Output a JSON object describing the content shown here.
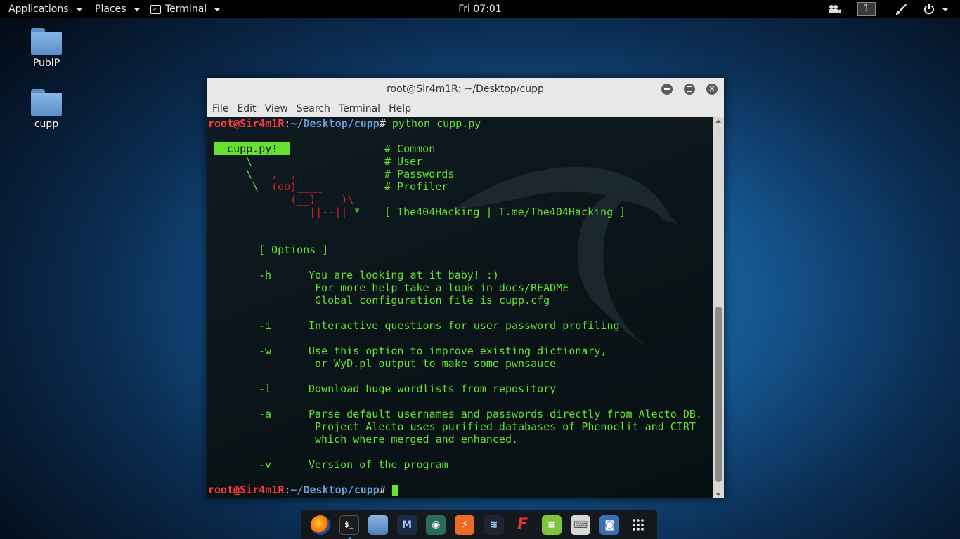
{
  "topbar": {
    "applications": "Applications",
    "places": "Places",
    "terminal_menu": "Terminal",
    "clock": "Fri 07:01",
    "workspace": "1"
  },
  "desktop": {
    "icons": [
      {
        "label": "PublP"
      },
      {
        "label": "cupp"
      }
    ]
  },
  "window": {
    "title": "root@Sir4m1R: ~/Desktop/cupp",
    "menu": [
      "File",
      "Edit",
      "View",
      "Search",
      "Terminal",
      "Help"
    ]
  },
  "terminal": {
    "prompt_user": "root@Sir4m1R",
    "prompt_sep": ":",
    "prompt_path": "~/Desktop/cupp",
    "prompt_end": "# ",
    "command": "python cupp.py",
    "banner_label": "  cupp.py!  ",
    "banner_comments": [
      "# Common",
      "# User",
      "# Passwords",
      "# Profiler"
    ],
    "ascii": [
      "\\",
      " \\   ,__,",
      "  \\  (oo)____",
      "     (__)    )\\",
      "        ||--|| *"
    ],
    "credit": "[ The404Hacking | T.me/The404Hacking ]",
    "options_header": "[ Options ]",
    "options": [
      {
        "flag": "-h",
        "lines": [
          "You are looking at it baby! :)",
          " For more help take a look in docs/README",
          " Global configuration file is cupp.cfg"
        ]
      },
      {
        "flag": "-i",
        "lines": [
          "Interactive questions for user password profiling"
        ]
      },
      {
        "flag": "-w",
        "lines": [
          "Use this option to improve existing dictionary,",
          " or WyD.pl output to make some pwnsauce"
        ]
      },
      {
        "flag": "-l",
        "lines": [
          "Download huge wordlists from repository"
        ]
      },
      {
        "flag": "-a",
        "lines": [
          "Parse default usernames and passwords directly from Alecto DB.",
          " Project Alecto uses purified databases of Phenoelit and CIRT",
          " which where merged and enhanced."
        ]
      },
      {
        "flag": "-v",
        "lines": [
          "Version of the program"
        ]
      }
    ]
  },
  "dock": {
    "apps": [
      "firefox-icon",
      "terminal-icon",
      "files-icon",
      "metasploit-icon",
      "armitage-icon",
      "burpsuite-icon",
      "kali-tools-icon",
      "faraday-icon",
      "notes-icon",
      "keyboard-icon",
      "screenshot-icon",
      "show-apps-icon"
    ],
    "terminal_glyph": "$_"
  }
}
